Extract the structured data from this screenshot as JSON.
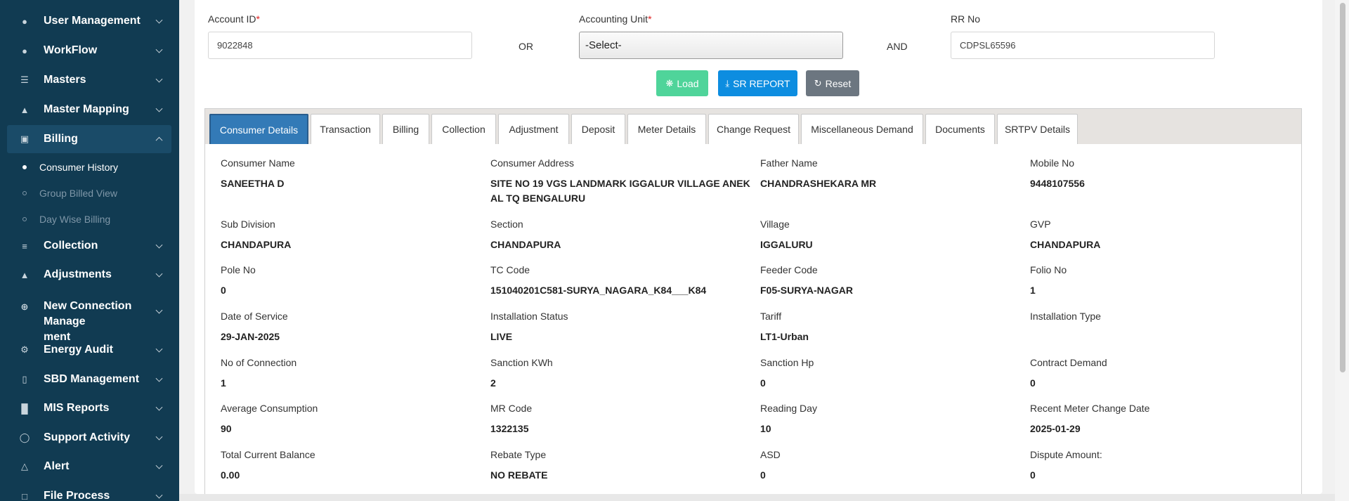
{
  "sidebar": {
    "items": [
      {
        "label": "User Management",
        "icon": "user-icon"
      },
      {
        "label": "WorkFlow",
        "icon": "user-icon"
      },
      {
        "label": "Masters",
        "icon": "list-icon"
      },
      {
        "label": "Master Mapping",
        "icon": "sitemap-icon"
      },
      {
        "label": "Billing",
        "icon": "monitor-icon"
      },
      {
        "label": "Collection",
        "icon": "list-icon"
      },
      {
        "label": "Adjustments",
        "icon": "users-icon"
      },
      {
        "label": "New Connection Management",
        "label_line1": "New Connection Manage",
        "label_line2": "ment",
        "icon": "plus-circle-icon"
      },
      {
        "label": "Energy Audit",
        "icon": "cogs-icon"
      },
      {
        "label": "SBD Management",
        "icon": "mobile-icon"
      },
      {
        "label": "MIS Reports",
        "icon": "bar-chart-icon"
      },
      {
        "label": "Support Activity",
        "icon": "headset-icon"
      },
      {
        "label": "Alert",
        "icon": "bell-icon"
      },
      {
        "label": "File Process",
        "icon": "file-icon"
      }
    ],
    "billing_sub": [
      {
        "label": "Consumer History"
      },
      {
        "label": "Group Billed View"
      },
      {
        "label": "Day Wise Billing"
      }
    ]
  },
  "search": {
    "account_id_label": "Account ID",
    "account_id_value": "9022848",
    "or_label": "OR",
    "accounting_unit_label": "Accounting Unit",
    "accounting_unit_value": "-Select-",
    "and_label": "AND",
    "rr_no_label": "RR No",
    "rr_no_value": "CDPSL65596",
    "required_mark": "*"
  },
  "buttons": {
    "load": "Load",
    "sr_report": "SR REPORT",
    "reset": "Reset"
  },
  "tabs": [
    {
      "label": "Consumer Details"
    },
    {
      "label": "Transaction"
    },
    {
      "label": "Billing"
    },
    {
      "label": "Collection"
    },
    {
      "label": "Adjustment"
    },
    {
      "label": "Deposit"
    },
    {
      "label": "Meter Details"
    },
    {
      "label": "Change Request"
    },
    {
      "label": "Miscellaneous Demand"
    },
    {
      "label": "Documents"
    },
    {
      "label": "SRTPV Details"
    }
  ],
  "details": [
    {
      "label": "Consumer Name",
      "value": "SANEETHA D"
    },
    {
      "label": "Consumer Address",
      "value": "SITE NO 19 VGS LANDMARK IGGALUR VILLAGE ANEKAL TQ BENGALURU",
      "value_line1": "SITE NO 19 VGS LANDMARK IGGALUR VILLAGE ANEK",
      "value_line2": "AL TQ BENGALURU"
    },
    {
      "label": "Father Name",
      "value": "CHANDRASHEKARA MR"
    },
    {
      "label": "Mobile No",
      "value": "9448107556"
    },
    {
      "label": "Sub Division",
      "value": "CHANDAPURA"
    },
    {
      "label": "Section",
      "value": "CHANDAPURA"
    },
    {
      "label": "Village",
      "value": "IGGALURU"
    },
    {
      "label": "GVP",
      "value": "CHANDAPURA"
    },
    {
      "label": "Pole No",
      "value": "0"
    },
    {
      "label": "TC Code",
      "value": "151040201C581-SURYA_NAGARA_K84___K84"
    },
    {
      "label": "Feeder Code",
      "value": "F05-SURYA-NAGAR"
    },
    {
      "label": "Folio No",
      "value": "1"
    },
    {
      "label": "Date of Service",
      "value": "29-JAN-2025"
    },
    {
      "label": "Installation Status",
      "value": "LIVE"
    },
    {
      "label": "Tariff",
      "value": "LT1-Urban"
    },
    {
      "label": "Installation Type",
      "value": ""
    },
    {
      "label": "No of Connection",
      "value": "1"
    },
    {
      "label": "Sanction KWh",
      "value": "2"
    },
    {
      "label": "Sanction Hp",
      "value": "0"
    },
    {
      "label": "Contract Demand",
      "value": "0"
    },
    {
      "label": "Average Consumption",
      "value": "90"
    },
    {
      "label": "MR Code",
      "value": "1322135"
    },
    {
      "label": "Reading Day",
      "value": "10"
    },
    {
      "label": "Recent Meter Change Date",
      "value": "2025-01-29"
    },
    {
      "label": "Total Current Balance",
      "value": "0.00"
    },
    {
      "label": "Rebate Type",
      "value": "NO REBATE"
    },
    {
      "label": "ASD",
      "value": "0"
    },
    {
      "label": "Dispute Amount:",
      "value": "0"
    }
  ],
  "colors": {
    "sidebar_bg": "#113b52",
    "tab_active": "#337ab7",
    "load_btn": "#4fd49a",
    "sr_btn": "#0d8de0",
    "reset_btn": "#6c7680"
  }
}
